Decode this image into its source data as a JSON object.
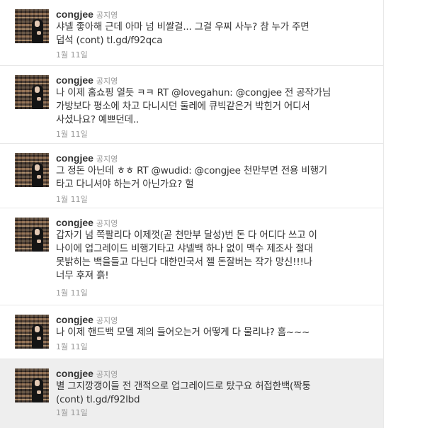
{
  "tweets": [
    {
      "screen_name": "congjee",
      "full_name": "공지영",
      "lines": [
        "샤넬 좋아해 근데 아마 넘 비쌀걸... 그걸 우찌 사누? 참 누가 주면",
        "덥석 (cont) tl.gd/f92qca"
      ],
      "time": "1월 11일"
    },
    {
      "screen_name": "congjee",
      "full_name": "공지영",
      "lines": [
        "나 이제 홈쇼핑 열듯 ㅋㅋ RT @lovegahun: @congjee 전 공작가님",
        "가방보다 평소에 차고 다니시던 둘레에 큐빅같은거 박힌거 어디서",
        "사셨나요? 예쁘던데.."
      ],
      "time": "1월 11일"
    },
    {
      "screen_name": "congjee",
      "full_name": "공지영",
      "lines": [
        "그 정돈 아닌데 ㅎㅎ RT @wudid: @congjee 천만부면 전용 비행기",
        "타고 다니셔야 하는거 아닌가요? 헐"
      ],
      "time": "1월 11일"
    },
    {
      "screen_name": "congjee",
      "full_name": "공지영",
      "lines": [
        "갑자기 넘 쪽팔리다 이제껏(곧 천만부 달성)번 돈 다 어디다 쓰고 이",
        "나이에 업그레이드 비행기타고 샤넬백 하나 없이 맥수 제조사 절대",
        "못밝히는 백을들고 다닌다 대한민국서 젤 돈잘버는 작가 망신!!!나",
        "너무 후져 흙!"
      ],
      "time": "1월 11일"
    },
    {
      "screen_name": "congjee",
      "full_name": "공지영",
      "lines": [
        "나 이제 핸드백 모델 제의 들어오는거 어떻게 다 물리냐? 흠~~~"
      ],
      "time": "1월 11일"
    },
    {
      "screen_name": "congjee",
      "full_name": "공지영",
      "lines": [
        "별 그지깡갱이들 전 갠적으로 업그레이드로 탔구요 허접한백(짝퉁",
        "(cont) tl.gd/f92lbd"
      ],
      "time": "1월 11일"
    }
  ]
}
